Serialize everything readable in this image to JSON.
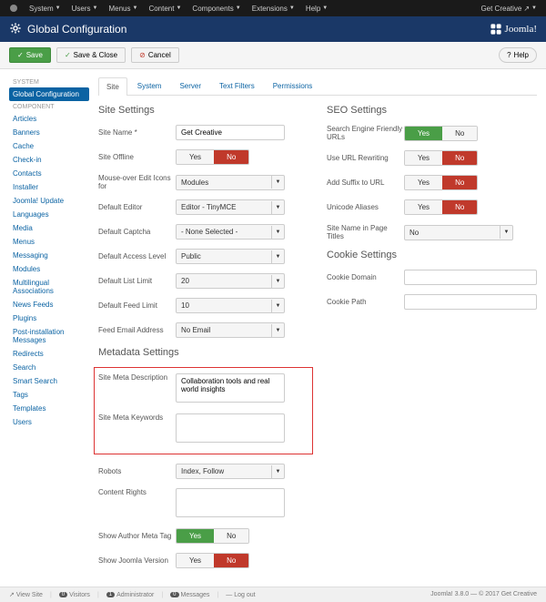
{
  "topmenu": [
    "System",
    "Users",
    "Menus",
    "Content",
    "Components",
    "Extensions",
    "Help"
  ],
  "topright": {
    "user": "Get Creative"
  },
  "header": {
    "title": "Global Configuration",
    "brand": "Joomla!"
  },
  "toolbar": {
    "save": "Save",
    "save_close": "Save & Close",
    "cancel": "Cancel",
    "help": "Help"
  },
  "sidebar": {
    "system_head": "SYSTEM",
    "system_items": [
      "Global Configuration"
    ],
    "component_head": "COMPONENT",
    "component_items": [
      "Articles",
      "Banners",
      "Cache",
      "Check-in",
      "Contacts",
      "Installer",
      "Joomla! Update",
      "Languages",
      "Media",
      "Menus",
      "Messaging",
      "Modules",
      "Multilingual Associations",
      "News Feeds",
      "Plugins",
      "Post-installation Messages",
      "Redirects",
      "Search",
      "Smart Search",
      "Tags",
      "Templates",
      "Users"
    ]
  },
  "tabs": [
    "Site",
    "System",
    "Server",
    "Text Filters",
    "Permissions"
  ],
  "site_settings": {
    "title": "Site Settings",
    "site_name_label": "Site Name *",
    "site_name": "Get Creative",
    "site_offline_label": "Site Offline",
    "mouseover_label": "Mouse-over Edit Icons for",
    "mouseover": "Modules",
    "default_editor_label": "Default Editor",
    "default_editor": "Editor - TinyMCE",
    "default_captcha_label": "Default Captcha",
    "default_captcha": "- None Selected -",
    "access_level_label": "Default Access Level",
    "access_level": "Public",
    "list_limit_label": "Default List Limit",
    "list_limit": "20",
    "feed_limit_label": "Default Feed Limit",
    "feed_limit": "10",
    "feed_email_label": "Feed Email Address",
    "feed_email": "No Email"
  },
  "metadata": {
    "title": "Metadata Settings",
    "desc_label": "Site Meta Description",
    "desc": "Collaboration tools and real world insights",
    "keywords_label": "Site Meta Keywords",
    "keywords": "",
    "robots_label": "Robots",
    "robots": "Index, Follow",
    "rights_label": "Content Rights",
    "rights": "",
    "author_label": "Show Author Meta Tag",
    "version_label": "Show Joomla Version"
  },
  "seo": {
    "title": "SEO Settings",
    "sef_label": "Search Engine Friendly URLs",
    "rewrite_label": "Use URL Rewriting",
    "suffix_label": "Add Suffix to URL",
    "unicode_label": "Unicode Aliases",
    "sitename_titles_label": "Site Name in Page Titles",
    "sitename_titles": "No"
  },
  "cookie": {
    "title": "Cookie Settings",
    "domain_label": "Cookie Domain",
    "path_label": "Cookie Path"
  },
  "yn": {
    "yes": "Yes",
    "no": "No"
  },
  "status": {
    "view_site": "View Site",
    "visitors_n": "0",
    "visitors": "Visitors",
    "admin_n": "1",
    "admin": "Administrator",
    "msg_n": "0",
    "msg": "Messages",
    "logout": "Log out",
    "right": "Joomla! 3.8.0 — © 2017 Get Creative"
  }
}
